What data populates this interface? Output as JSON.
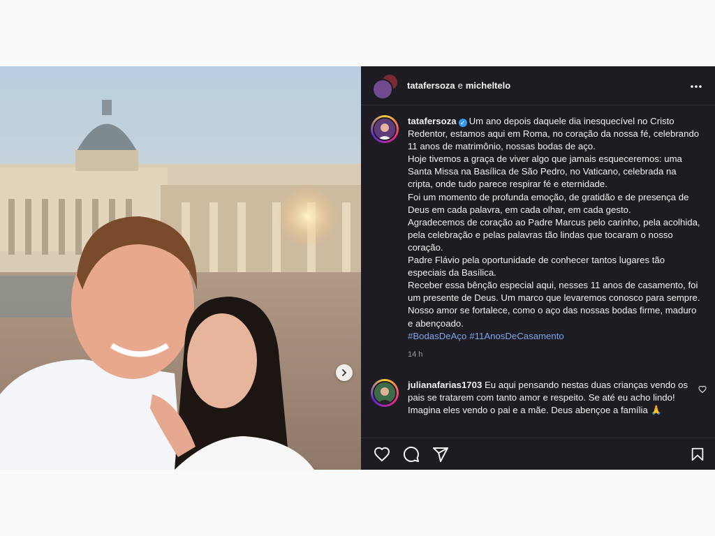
{
  "post": {
    "header": {
      "user1": "tatafersoza",
      "connector": "e",
      "user2": "micheltelo",
      "more_icon": "more-horizontal-icon"
    },
    "caption": {
      "username": "tatafersoza",
      "verified_icon": "verified-badge-icon",
      "lines": [
        "Um ano depois daquele dia inesquecível no Cristo Redentor, estamos aqui em Roma, no coração da nossa fé, celebrando 11 anos de matrimônio, nossas bodas de aço.",
        "Hoje tivemos a graça de viver algo que jamais esqueceremos: uma Santa Missa na Basílica de São Pedro, no Vaticano, celebrada na cripta, onde tudo parece respirar fé e eternidade.",
        "Foi um momento de profunda emoção, de gratidão e de presença de Deus em cada palavra, em cada olhar, em cada gesto.",
        "Agradecemos de coração ao Padre Marcus pelo carinho, pela acolhida, pela celebração e pelas palavras tão lindas que tocaram o nosso coração.",
        "Padre Flávio pela oportunidade de conhecer tantos lugares tão especiais da Basílica.",
        "Receber essa bênção especial aqui, nesses 11 anos de casamento, foi um presente de Deus. Um marco que levaremos conosco para sempre.",
        "Nosso amor se fortalece, como o aço das nossas bodas firme, maduro e abençoado."
      ],
      "hashtags": [
        "#BodasDeAço",
        "#11AnosDeCasamento"
      ],
      "time": "14 h"
    },
    "comment": {
      "username": "julianafarias1703",
      "text": "Eu aqui pensando nestas duas crianças vendo os pais se tratarem com tanto amor e respeito. Se até eu acho lindo! Imagina eles vendo o pai e a mãe. Deus abençoe a família 🙏"
    },
    "colors": {
      "panel_bg": "#1c1c22",
      "hashtag": "#7fa5e8",
      "verified": "#3897f0"
    },
    "actions": {
      "like": "heart-icon",
      "comment": "comment-icon",
      "share": "send-icon",
      "save": "bookmark-icon"
    }
  }
}
